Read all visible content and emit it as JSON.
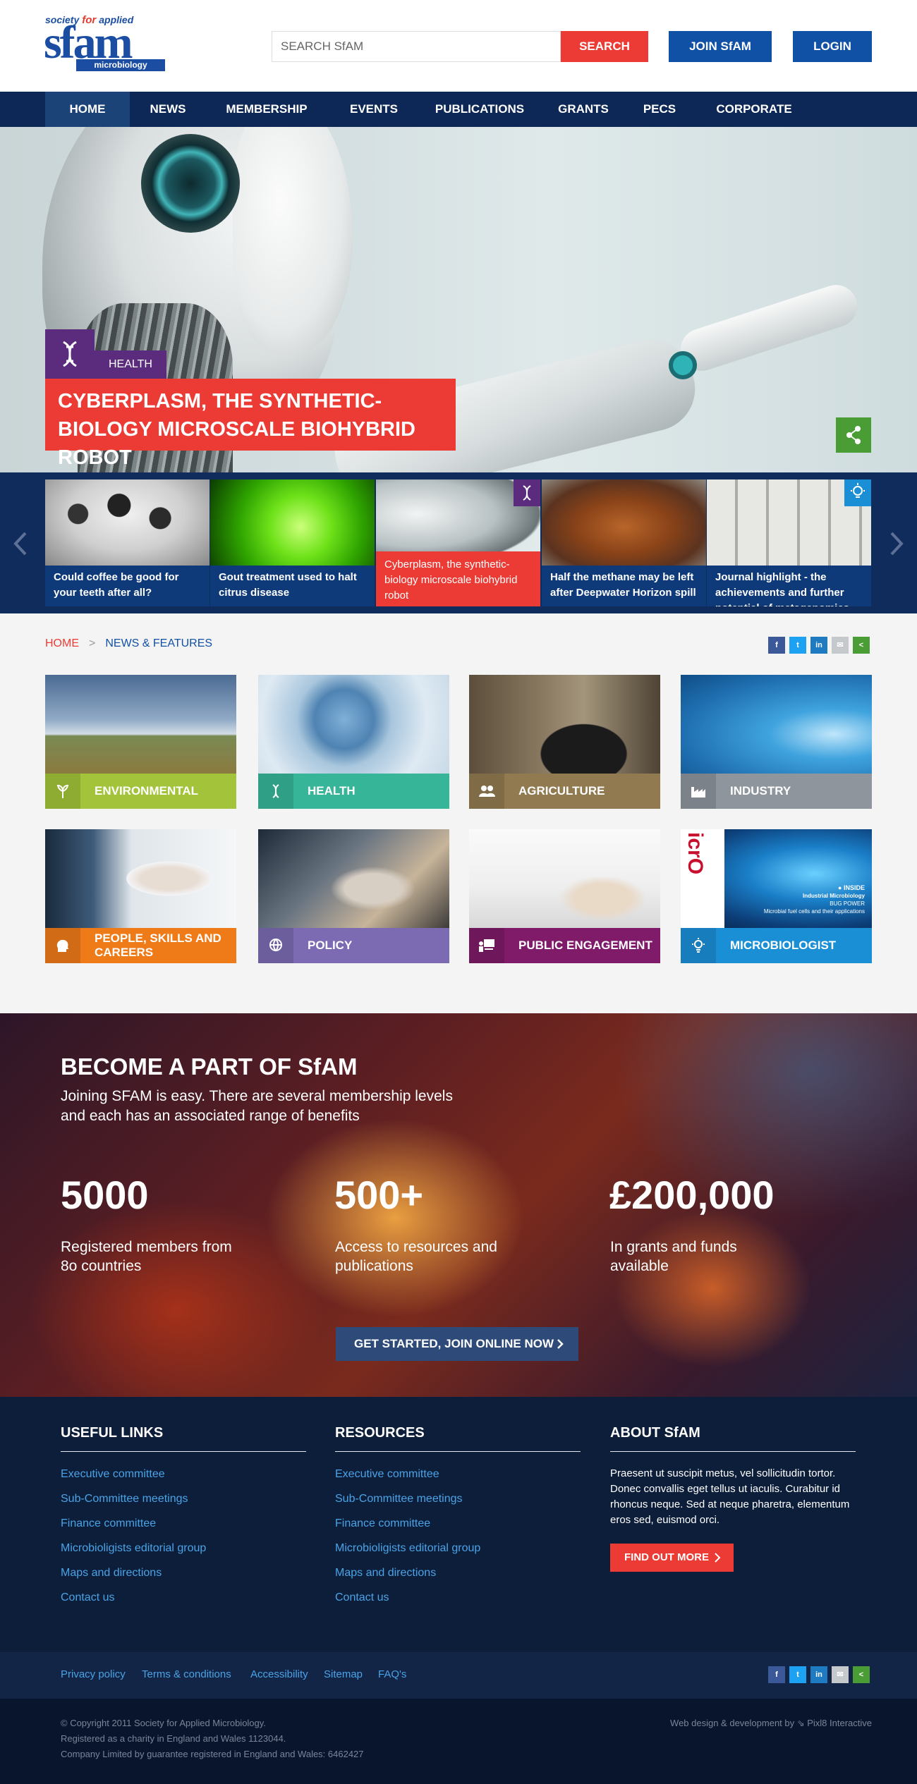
{
  "header": {
    "logo": {
      "top": "society for applied",
      "top_a": "society",
      "top_b": "for",
      "top_c": "applied",
      "main": "sfam",
      "bottom": "microbiology"
    },
    "search_placeholder": "SEARCH SfAM",
    "search_button": "SEARCH",
    "join_button": "JOIN SfAM",
    "login_button": "LOGIN"
  },
  "nav": [
    "HOME",
    "NEWS",
    "MEMBERSHIP",
    "EVENTS",
    "PUBLICATIONS",
    "GRANTS",
    "PECS",
    "CORPORATE"
  ],
  "hero": {
    "category": "HEALTH",
    "title": "CYBERPLASM, THE SYNTHETIC-BIOLOGY MICROSCALE BIOHYBRID ROBOT"
  },
  "carousel": [
    {
      "text": "Could coffee be good for your teeth after all?"
    },
    {
      "text": "Gout treatment used to halt citrus disease"
    },
    {
      "text": "Cyberplasm, the synthetic-biology microscale biohybrid robot"
    },
    {
      "text": "Half the methane may be left after Deepwater Horizon spill"
    },
    {
      "text": "Journal highlight - the achievements and further potential of metagenomics"
    }
  ],
  "breadcrumb": {
    "home": "HOME",
    "current": "NEWS & FEATURES"
  },
  "share": [
    "f",
    "t",
    "in",
    "✉",
    "<"
  ],
  "tiles": [
    {
      "label": "ENVIRONMENTAL",
      "color": "#a3c43a",
      "icon": "leaf-icon"
    },
    {
      "label": "HEALTH",
      "color": "#36b598",
      "icon": "dna-icon"
    },
    {
      "label": "AGRICULTURE",
      "color": "#917a4f",
      "icon": "people-icon"
    },
    {
      "label": "INDUSTRY",
      "color": "#8e959c",
      "icon": "factory-icon"
    },
    {
      "label": "PEOPLE, SKILLS AND CAREERS",
      "color": "#ef7a18",
      "icon": "head-icon"
    },
    {
      "label": "POLICY",
      "color": "#7c6ab2",
      "icon": "globe-icon"
    },
    {
      "label": "PUBLIC ENGAGEMENT",
      "color": "#7f1b68",
      "icon": "presentation-icon"
    },
    {
      "label": "MICROBIOLOGIST",
      "color": "#1b8fd6",
      "icon": "bulb-icon"
    }
  ],
  "magazine": {
    "brand": "icrO",
    "inside": "● INSIDE",
    "line1": "Industrial Microbiology",
    "line2": "BUG POWER",
    "line3": "Microbial fuel cells and their applications"
  },
  "become": {
    "title": "BECOME A PART OF SfAM",
    "subtitle": "Joining SFAM is easy. There are several membership levels and each has an associated range of benefits",
    "stats": [
      {
        "number": "5000",
        "text": "Registered members from 8o countries"
      },
      {
        "number": "500+",
        "text": "Access to resources and publications"
      },
      {
        "number": "£200,000",
        "text": "In grants and funds available"
      }
    ],
    "cta": "GET STARTED, JOIN ONLINE NOW"
  },
  "footer": {
    "useful_links": {
      "title": "USEFUL LINKS",
      "links": [
        "Executive committee",
        "Sub-Committee meetings",
        "Finance committee",
        "Microbioligists editorial group",
        "Maps and directions",
        "Contact us"
      ]
    },
    "resources": {
      "title": "RESOURCES",
      "links": [
        "Executive committee",
        "Sub-Committee meetings",
        "Finance committee",
        "Microbioligists editorial group",
        "Maps and directions",
        "Contact us"
      ]
    },
    "about": {
      "title": "ABOUT SfAM",
      "text": "Praesent ut suscipit metus, vel sollicitudin tortor. Donec convallis eget tellus ut iaculis. Curabitur id rhoncus neque. Sed at neque pharetra, elementum eros sed, euismod orci.",
      "button": "FIND OUT MORE"
    },
    "bottom_links": [
      "Privacy policy",
      "Terms & conditions",
      "Accessibility",
      "Sitemap",
      "FAQ's"
    ],
    "copyright": [
      "© Copyright 2011 Society for Applied Microbiology.",
      "Registered as a charity in England and Wales 1123044.",
      "Company Limited by guarantee registered in England and Wales: 6462427"
    ],
    "credit": "Web design & development by  ⇘ Pixl8 Interactive"
  },
  "colors": {
    "red": "#ec3b35",
    "blue": "#1151a5",
    "navy": "#0d2756",
    "purple": "#5b2c7e",
    "green": "#4a9c35"
  }
}
